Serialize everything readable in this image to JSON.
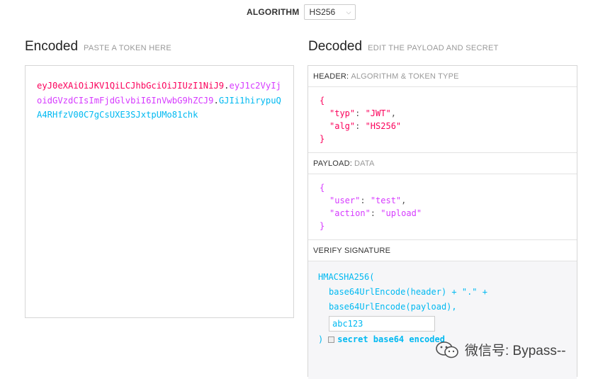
{
  "algorithm": {
    "label": "ALGORITHM",
    "selected": "HS256"
  },
  "encoded": {
    "title": "Encoded",
    "subtitle": "PASTE A TOKEN HERE",
    "token_header": "eyJ0eXAiOiJKV1QiLCJhbGciOiJIUzI1NiJ9",
    "dot1": ".",
    "token_payload": "eyJ1c2VyIjoidGVzdCIsImFjdGlvbiI6InVwbG9hZCJ9",
    "dot2": ".",
    "token_signature": "GJIi1hirypuQA4RHfzV00C7gCsUXE3SJxtpUMo81chk"
  },
  "decoded": {
    "title": "Decoded",
    "subtitle": "EDIT THE PAYLOAD AND SECRET",
    "header_panel": {
      "title": "HEADER:",
      "subtitle": "ALGORITHM & TOKEN TYPE",
      "open": "{",
      "close": "}",
      "lines": [
        {
          "key": "\"typ\"",
          "sep": ": ",
          "value": "\"JWT\"",
          "trail": ","
        },
        {
          "key": "\"alg\"",
          "sep": ": ",
          "value": "\"HS256\"",
          "trail": ""
        }
      ]
    },
    "payload_panel": {
      "title": "PAYLOAD:",
      "subtitle": "DATA",
      "open": "{",
      "close": "}",
      "lines": [
        {
          "key": "\"user\"",
          "sep": ": ",
          "value": "\"test\"",
          "trail": ","
        },
        {
          "key": "\"action\"",
          "sep": ": ",
          "value": "\"upload\"",
          "trail": ""
        }
      ]
    },
    "verify_panel": {
      "title": "VERIFY SIGNATURE",
      "fn": "HMACSHA256(",
      "line1": "base64UrlEncode(header) + \".\" +",
      "line2": "base64UrlEncode(payload),",
      "secret_value": "abc123",
      "close": ")",
      "secret_label": "secret base64 encoded"
    }
  },
  "watermark": {
    "text": "微信号: Bypass--"
  },
  "colors": {
    "header": "#fb015b",
    "payload": "#d63aff",
    "signature": "#00b9f1"
  }
}
